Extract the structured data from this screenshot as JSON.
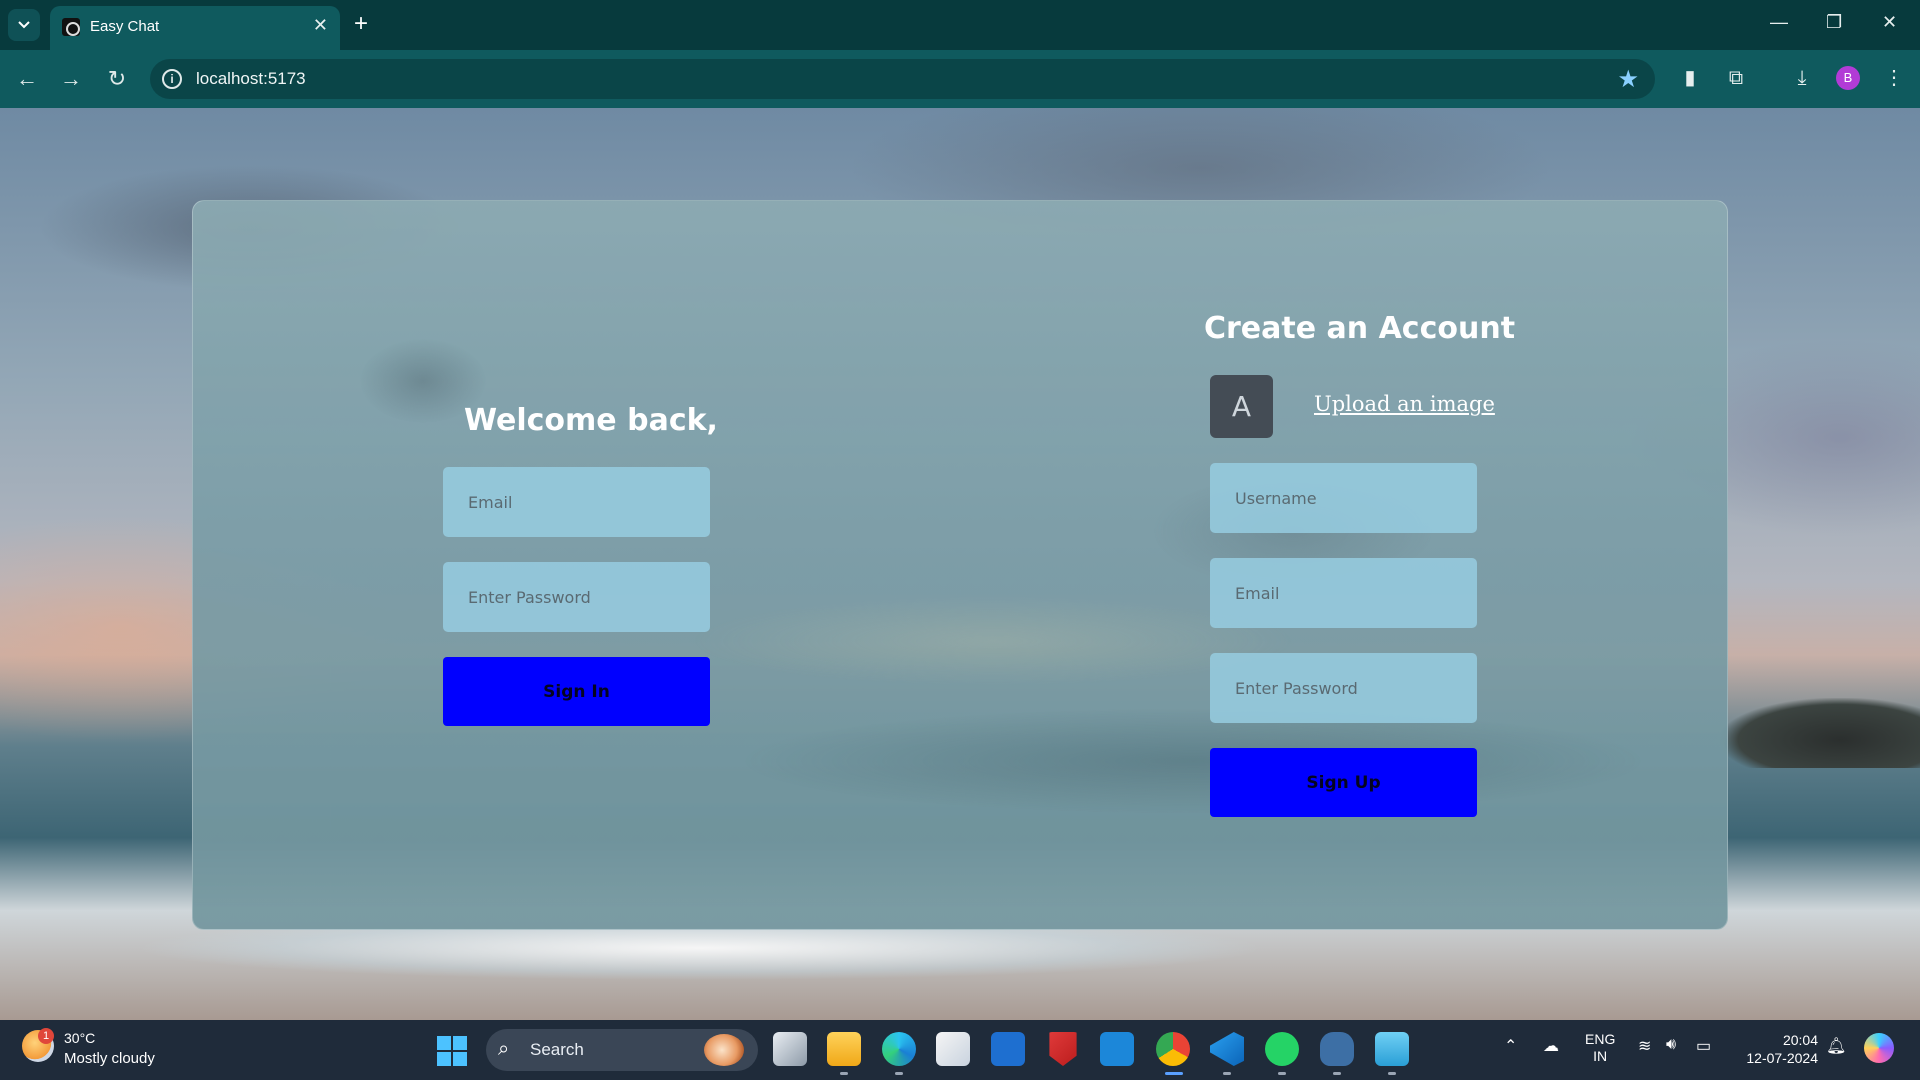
{
  "browser": {
    "tab_title": "Easy Chat",
    "new_tab_symbol": "+",
    "url": "localhost:5173",
    "profile_initial": "B"
  },
  "login": {
    "heading": "Welcome back,",
    "email_placeholder": "Email",
    "password_placeholder": "Enter Password",
    "submit_label": "Sign In"
  },
  "register": {
    "heading": "Create an Account",
    "avatar_initial": "A",
    "upload_label": "Upload an image",
    "username_placeholder": "Username",
    "email_placeholder": "Email",
    "password_placeholder": "Enter Password",
    "submit_label": "Sign Up"
  },
  "taskbar": {
    "weather_badge": "1",
    "temperature": "30°C",
    "weather_desc": "Mostly cloudy",
    "search_label": "Search",
    "lang_line1": "ENG",
    "lang_line2": "IN",
    "time": "20:04",
    "date": "12-07-2024"
  },
  "colors": {
    "primary_button": "#0000ff",
    "input_bg": "#96cde1",
    "chrome_bg": "#0f5a5e",
    "taskbar_bg": "#1f2b3a"
  }
}
